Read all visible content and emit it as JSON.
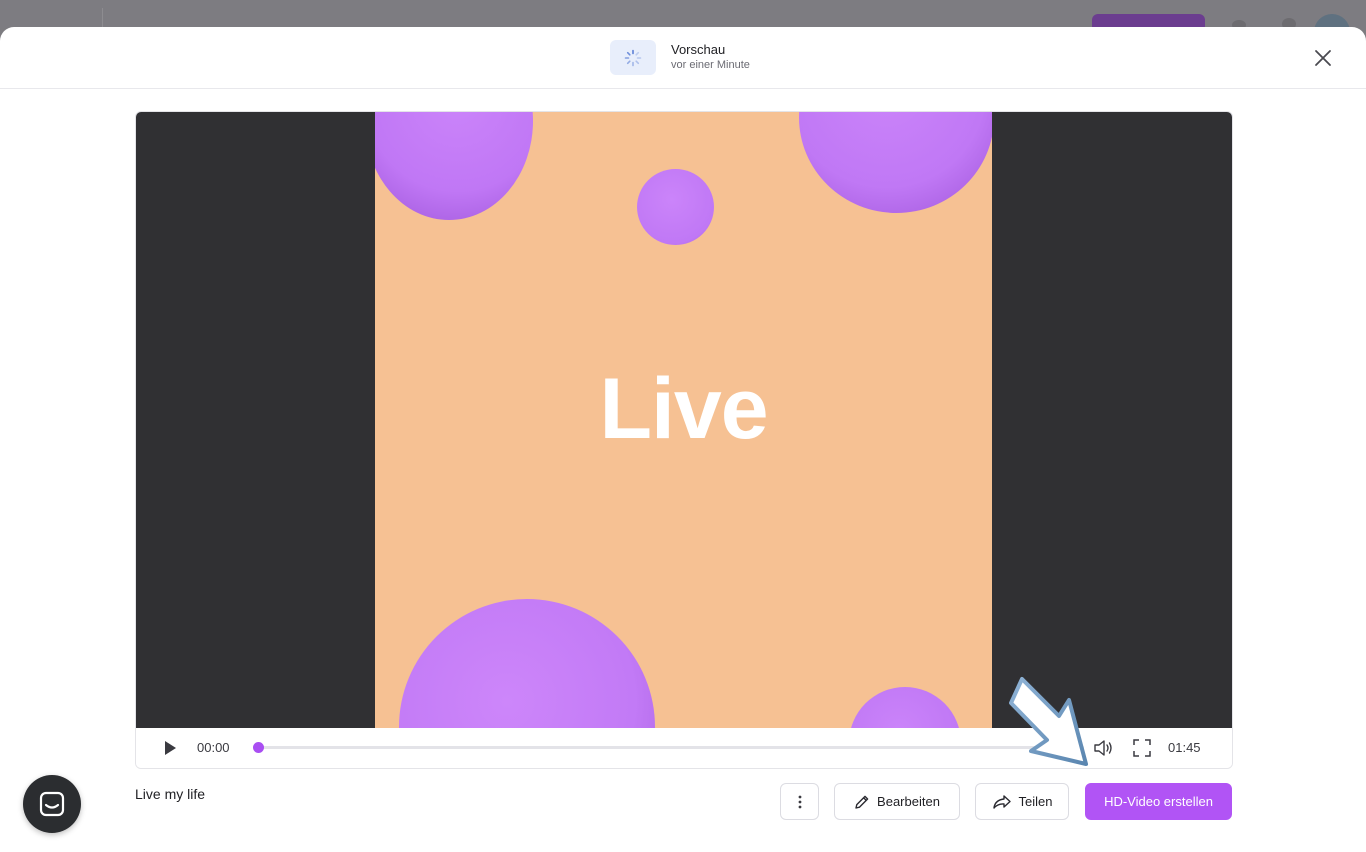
{
  "header": {
    "title": "Vorschau",
    "subtitle": "vor einer Minute",
    "status_icon": "loading-spinner-icon",
    "close_icon": "close-icon"
  },
  "video": {
    "overlay_text": "Live",
    "background_color": "#f6c193",
    "letterbox_color": "#303033",
    "ball_color": "#c77cf7"
  },
  "player": {
    "current_time": "00:00",
    "total_time": "01:45",
    "progress_fraction": 0,
    "accent_color": "#b153f5",
    "play_icon": "play-icon",
    "volume_icon": "volume-icon",
    "fullscreen_icon": "fullscreen-icon"
  },
  "footer": {
    "video_title": "Live my life",
    "more_icon": "more-vertical-icon",
    "edit_label": "Bearbeiten",
    "edit_icon": "pencil-icon",
    "share_label": "Teilen",
    "share_icon": "share-icon",
    "hd_label": "HD-Video erstellen",
    "hd_color": "#b154f5"
  },
  "chat": {
    "icon": "chat-icon"
  },
  "annotation": {
    "icon": "pointer-arrow-icon"
  }
}
